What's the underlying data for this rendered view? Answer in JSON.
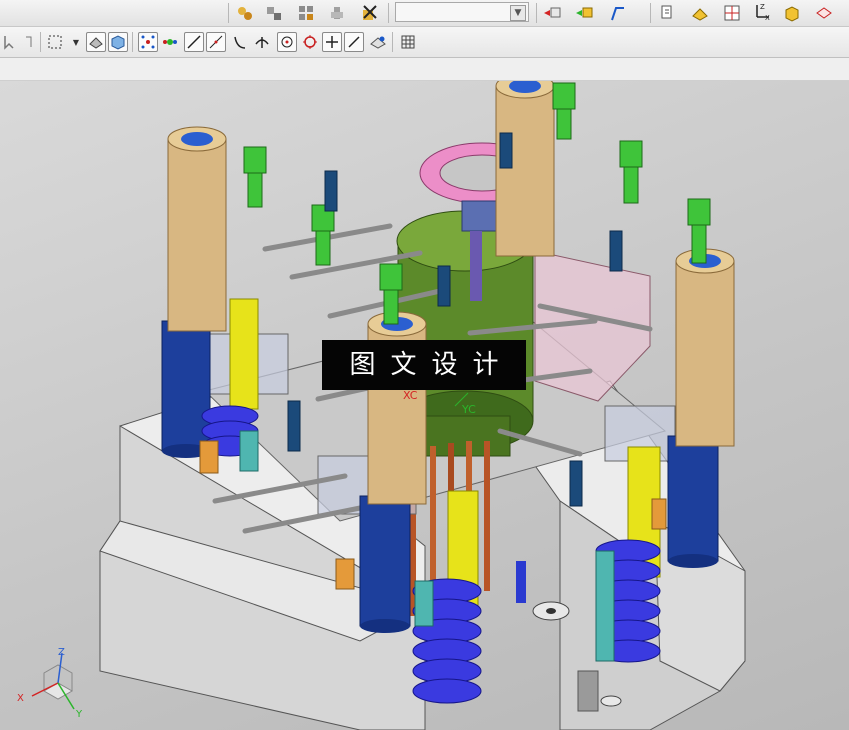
{
  "toolbar_top": {
    "buttons": [
      "assembly-icon",
      "component-icon",
      "pattern-icon",
      "move-icon",
      "delete-icon"
    ],
    "view_buttons": [
      "view-icon",
      "render-icon",
      "curve-icon",
      "layer-icon",
      "fit-icon",
      "orient-icon",
      "wcs-icon",
      "shade-icon",
      "section-icon"
    ]
  },
  "toolbar_bottom": {
    "buttons": [
      "select-icon",
      "box-select-icon",
      "shaded-icon",
      "solid-icon",
      "snap-point-icon",
      "snap-grid-icon",
      "line-icon",
      "angle-line-icon",
      "arc-icon",
      "corner-icon",
      "circle-icon",
      "circle-alt-icon",
      "cross-icon",
      "slant-icon",
      "measure-icon",
      "grid-icon"
    ]
  },
  "viewport": {
    "watermark": "图文设计",
    "xc_label": "XC",
    "yc_label": "YC",
    "triad": {
      "x": "X",
      "y": "Y",
      "z": "Z"
    },
    "colors": {
      "pillar_tan": "#d8b782",
      "pillar_blue": "#1d3f9c",
      "green_bolt": "#3fc43a",
      "yellow_pin": "#e7e31a",
      "pink_ring": "#ec8ec8",
      "cylinder": "#5c8a2a"
    }
  }
}
